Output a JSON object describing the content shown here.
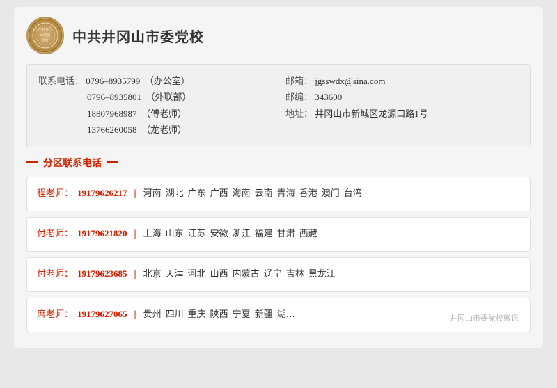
{
  "header": {
    "logo_text": "中共井冈\n山市委\n党校",
    "org_name": "中共井冈山市委党校"
  },
  "contact_info": {
    "phone_label": "联系电话：",
    "phones": [
      {
        "number": "0796–8935799",
        "note": "（办公室）"
      },
      {
        "number": "0796–8935801",
        "note": "（外联部）"
      },
      {
        "number": "18807968987",
        "note": "（傅老师）"
      },
      {
        "number": "13766260058",
        "note": "（龙老师）"
      }
    ],
    "email_label": "邮箱：",
    "email": "jgsswdx@sina.com",
    "postcode_label": "邮编：",
    "postcode": "343600",
    "address_label": "地址：",
    "address": "井冈山市新城区龙源口路1号"
  },
  "section_title": "分区联系电话",
  "contacts": [
    {
      "name": "程老师：",
      "phone": "19179626217",
      "regions": [
        "河南",
        "湖北",
        "广东",
        "广西",
        "海南",
        "云南",
        "青海",
        "香港",
        "澳门",
        "台湾"
      ]
    },
    {
      "name": "付老师：",
      "phone": "19179621820",
      "regions": [
        "上海",
        "山东",
        "江苏",
        "安徽",
        "浙江",
        "福建",
        "甘肃",
        "西藏"
      ]
    },
    {
      "name": "付老师：",
      "phone": "19179623685",
      "regions": [
        "北京",
        "天津",
        "河北",
        "山西",
        "内蒙古",
        "辽宁",
        "吉林",
        "黑龙江"
      ]
    },
    {
      "name": "席老师：",
      "phone": "19179627065",
      "regions": [
        "贵州",
        "四川",
        "重庆",
        "陕西",
        "宁夏",
        "新疆",
        "湖…"
      ]
    }
  ],
  "watermark": "井冈山市委党校微讯"
}
